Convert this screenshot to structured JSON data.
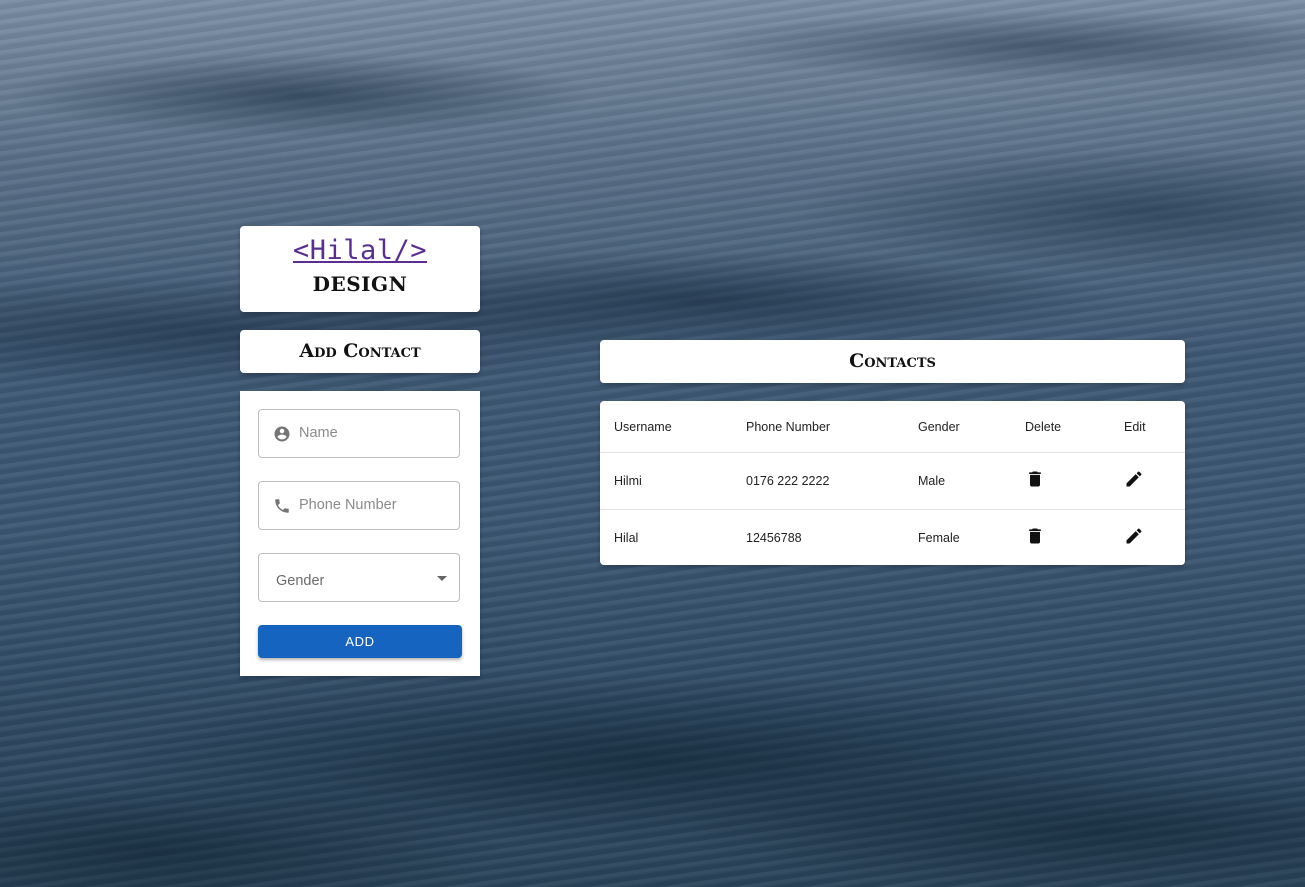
{
  "logo": {
    "title": "<Hilal/>",
    "subtitle": "DESIGN"
  },
  "add_contact": {
    "heading": "Add Contact",
    "name_placeholder": "Name",
    "name_icon": "account-circle-icon",
    "phone_placeholder": "Phone Number",
    "phone_icon": "phone-icon",
    "gender_label": "Gender",
    "gender_options": [],
    "add_label": "ADD"
  },
  "contacts": {
    "heading": "Contacts",
    "columns": [
      "Username",
      "Phone Number",
      "Gender",
      "Delete",
      "Edit"
    ],
    "rows": [
      {
        "username": "Hilmi",
        "phone": "0176 222 2222",
        "gender": "Male"
      },
      {
        "username": "Hilal",
        "phone": "12456788",
        "gender": "Female"
      }
    ],
    "delete_icon": "trash-icon",
    "edit_icon": "pencil-icon"
  },
  "colors": {
    "primary_button": "#1565c0",
    "logo_link": "#5b2d91"
  }
}
